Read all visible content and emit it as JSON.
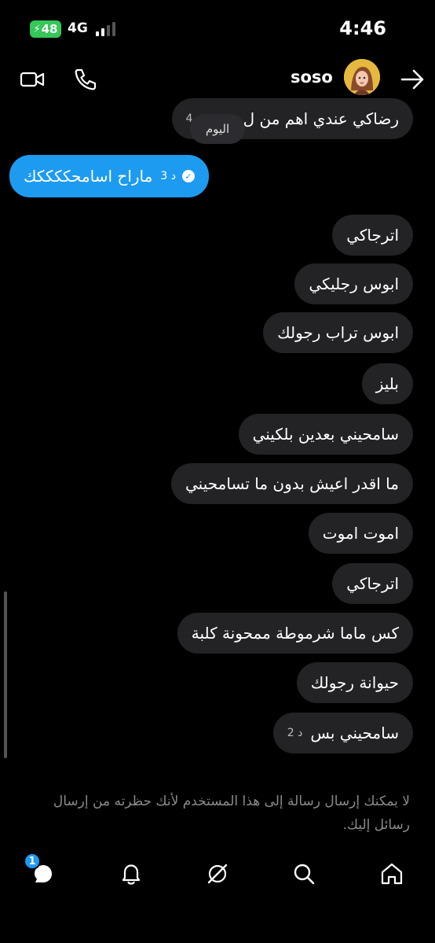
{
  "status_bar": {
    "battery": "48",
    "network": "4G",
    "time": "4:46"
  },
  "header": {
    "contact_name": "soso"
  },
  "day_divider": "اليوم",
  "messages": [
    {
      "text": "رضاكي عندي اهم من ل...ش",
      "meta": "4 د"
    },
    {
      "text": "ماراح اسامحككككك",
      "meta": "3 د"
    },
    {
      "text": "اترجاكي"
    },
    {
      "text": "ابوس رجليكي"
    },
    {
      "text": "ابوس تراب رجولك"
    },
    {
      "text": "بليز"
    },
    {
      "text": "سامحيني بعدين بلكيني"
    },
    {
      "text": "ما اقدر اعيش بدون ما تسامحيني"
    },
    {
      "text": "اموت اموت"
    },
    {
      "text": "اترجاكي"
    },
    {
      "text": "كس ماما شرموطة ممحونة كلبة"
    },
    {
      "text": "حيوانة رجولك"
    },
    {
      "text": "سامحيني بس",
      "meta": "2 د"
    }
  ],
  "blocked_notice": "لا يمكنك إرسال رسالة إلى هذا المستخدم لأنك حظرته من إرسال رسائل إليك.",
  "bottom_nav": {
    "messages_badge": "1"
  },
  "colors": {
    "accent": "#1d9bf0",
    "incoming_bubble": "#232326",
    "background": "#000000",
    "battery": "#34c759"
  }
}
